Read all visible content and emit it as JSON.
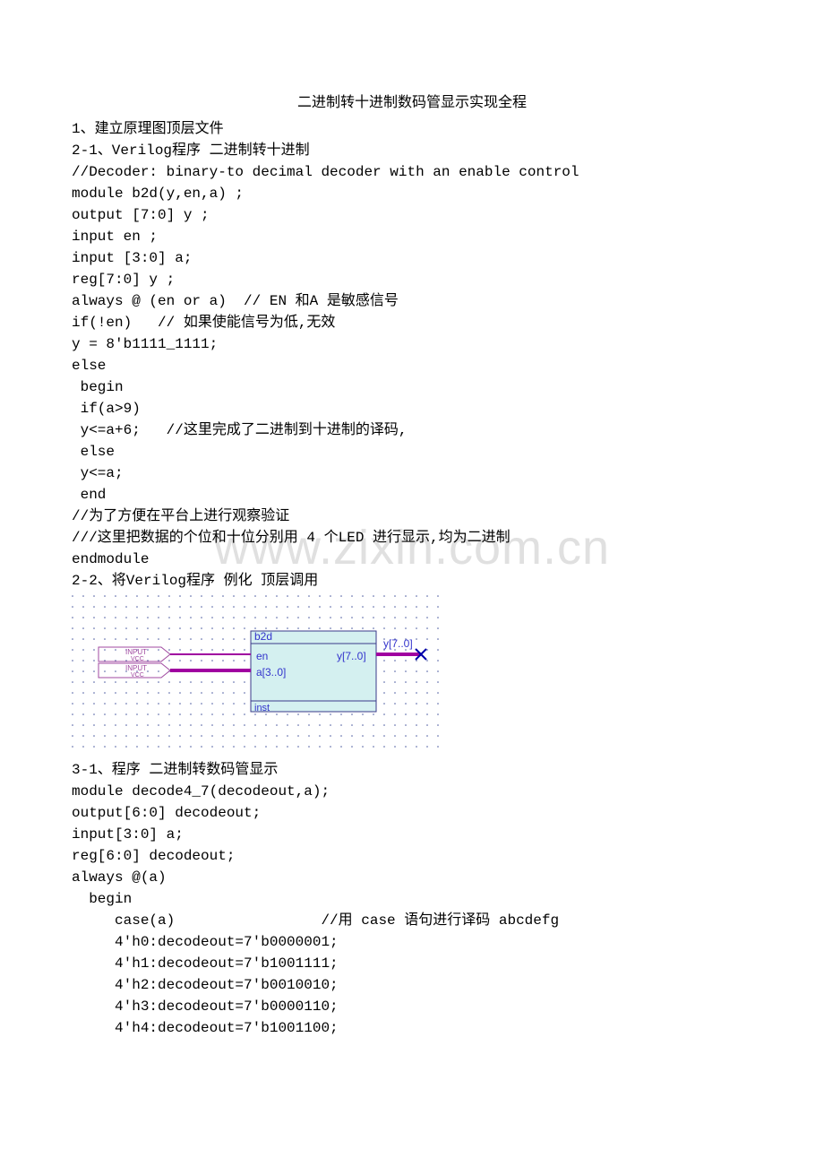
{
  "title": "二进制转十进制数码管显示实现全程",
  "section1": "1、建立原理图顶层文件",
  "section2_1": "2-1、Verilog程序 二进制转十进制",
  "code1": [
    "//Decoder: binary-to decimal decoder with an enable control",
    "module b2d(y,en,a) ;",
    "output [7:0] y ;",
    "input en ;",
    "input [3:0] a;",
    "reg[7:0] y ;",
    "always @ (en or a)  // EN 和A 是敏感信号",
    "if(!en)   // 如果使能信号为低,无效",
    "y = 8'b1111_1111;",
    "else",
    " begin",
    " if(a>9)",
    " y<=a+6;   //这里完成了二进制到十进制的译码,",
    " else",
    " y<=a;",
    " end",
    "//为了方便在平台上进行观察验证",
    "///这里把数据的个位和十位分别用 4 个LED 进行显示,均为二进制",
    "endmodule"
  ],
  "section2_2": "2-2、将Verilog程序 例化 顶层调用",
  "diagram": {
    "block_name": "b2d",
    "inst_label": "inst",
    "port_en": "en",
    "port_a": "a[3..0]",
    "port_y": "y[7..0]",
    "wire_y": "y[7..0]",
    "input_label": "INPUT",
    "vcc_label": "VCC"
  },
  "section3_1": "3-1、程序 二进制转数码管显示",
  "code2": [
    "module decode4_7(decodeout,a);",
    "output[6:0] decodeout;",
    "input[3:0] a;",
    "reg[6:0] decodeout;",
    "always @(a)",
    "  begin",
    "     case(a)                 //用 case 语句进行译码 abcdefg",
    "     4'h0:decodeout=7'b0000001;",
    "     4'h1:decodeout=7'b1001111;",
    "     4'h2:decodeout=7'b0010010;",
    "     4'h3:decodeout=7'b0000110;",
    "     4'h4:decodeout=7'b1001100;"
  ],
  "watermark": "www.zixin.com.cn"
}
